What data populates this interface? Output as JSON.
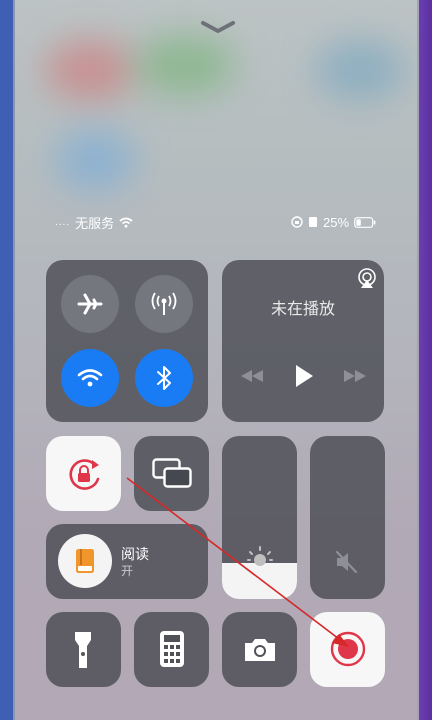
{
  "status_bar": {
    "signal_dots": "....",
    "carrier": "无服务",
    "battery_percent": "25%"
  },
  "media": {
    "now_playing": "未在播放"
  },
  "reading_mode": {
    "title": "阅读",
    "state": "开"
  },
  "levels": {
    "brightness_fraction": 0.22,
    "volume_fraction": 0.0
  },
  "colors": {
    "accent_blue": "#1a7cf4",
    "record_red": "#e0364a",
    "annotation_red": "#d62828"
  },
  "icons": [
    "chevron-down-icon",
    "wifi-icon",
    "screen-rotation-lock-icon",
    "battery-icon",
    "airplay-icon",
    "airplane-icon",
    "cellular-icon",
    "bluetooth-icon",
    "rewind-icon",
    "play-icon",
    "fast-forward-icon",
    "orientation-lock-icon",
    "screen-mirroring-icon",
    "book-icon",
    "sun-icon",
    "mute-icon",
    "flashlight-icon",
    "calculator-icon",
    "camera-icon",
    "screen-record-icon"
  ]
}
